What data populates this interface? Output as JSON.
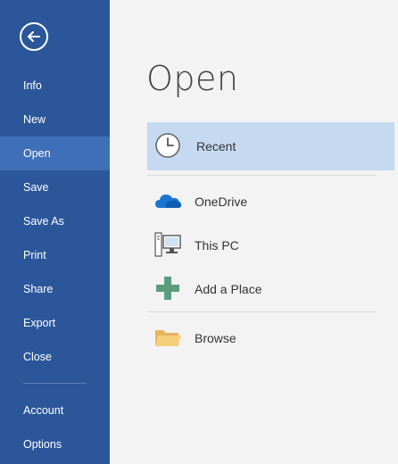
{
  "sidebar": {
    "back_icon": "back-arrow-icon",
    "items": [
      {
        "label": "Info"
      },
      {
        "label": "New"
      },
      {
        "label": "Open"
      },
      {
        "label": "Save"
      },
      {
        "label": "Save As"
      },
      {
        "label": "Print"
      },
      {
        "label": "Share"
      },
      {
        "label": "Export"
      },
      {
        "label": "Close"
      },
      {
        "label": "Account"
      },
      {
        "label": "Options"
      }
    ],
    "active_item": "Open"
  },
  "main": {
    "title": "Open",
    "locations": [
      {
        "label": "Recent",
        "icon": "clock-icon",
        "selected": true
      },
      {
        "label": "OneDrive",
        "icon": "cloud-icon"
      },
      {
        "label": "This PC",
        "icon": "computer-icon"
      },
      {
        "label": "Add a Place",
        "icon": "plus-icon"
      },
      {
        "label": "Browse",
        "icon": "folder-icon"
      }
    ]
  },
  "colors": {
    "sidebar": "#2b579a",
    "sidebar_active": "#3f6fb8",
    "selected_location": "#c5d9f1",
    "background": "#f3f3f3"
  }
}
